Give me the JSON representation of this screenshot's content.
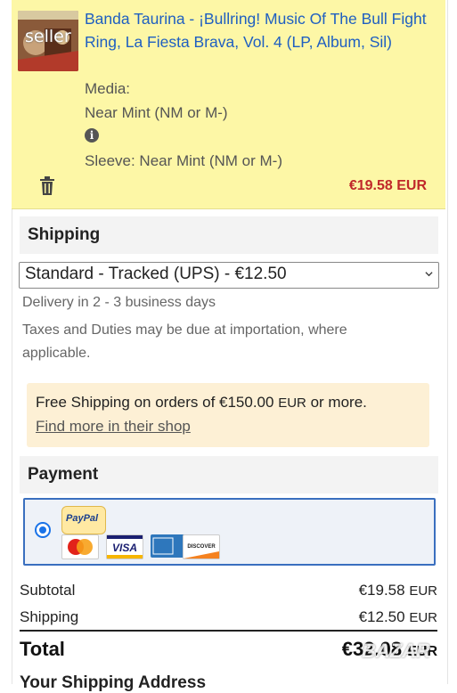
{
  "item": {
    "title": "Banda Taurina - ¡Bullring! Music Of The Bull Fight Ring, La Fiesta Brava, Vol. 4 (LP, Album, Sil)",
    "media_label": "Media:",
    "media_value": "Near Mint (NM or M-)",
    "sleeve": "Sleeve: Near Mint (NM or M-)",
    "price": "€19.58 EUR",
    "thumb_overlay": "seller"
  },
  "shipping": {
    "heading": "Shipping",
    "selected_option": "Standard - Tracked (UPS) - €12.50",
    "delivery": "Delivery in 2 - 3 business days",
    "taxes": "Taxes and Duties may be due at importation, where applicable.",
    "notice_prefix": "Free Shipping on orders of €150.00",
    "notice_currency": "EUR",
    "notice_suffix": " or more.",
    "notice_link": "Find more in their shop"
  },
  "payment": {
    "heading": "Payment",
    "paypal_label": "PayPal",
    "cards": [
      "MasterCard",
      "VISA",
      "AMEX",
      "DISCOVER"
    ]
  },
  "summary": {
    "subtotal_label": "Subtotal",
    "subtotal_value": "€19.58",
    "subtotal_currency": "EUR",
    "shipping_label": "Shipping",
    "shipping_value": "€12.50",
    "shipping_currency": "EUR",
    "total_label": "Total",
    "total_value": "€32.08",
    "total_currency": "EUR"
  },
  "next_section": "Your Shipping Address",
  "watermark": "BAZAR",
  "colors": {
    "item_bg": "#fdf7a6",
    "link": "#1f5fc1",
    "price": "#c0282a",
    "notice_bg": "#fdf0d5",
    "accent": "#1a73e8"
  }
}
